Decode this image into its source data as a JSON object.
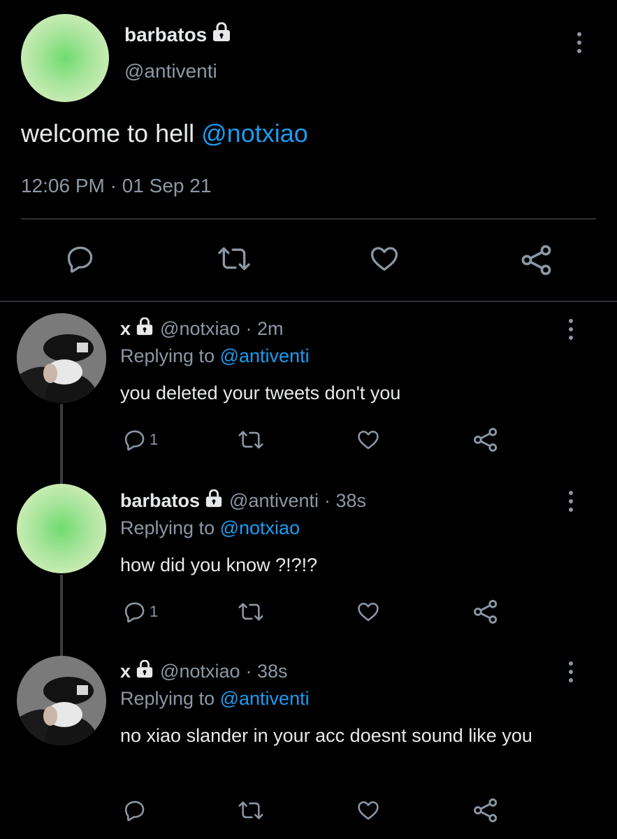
{
  "main_tweet": {
    "name": "barbatos",
    "handle": "@antiventi",
    "text": "welcome to hell",
    "mention": "@notxiao",
    "timestamp": "12:06 PM · 01 Sep 21"
  },
  "replies": [
    {
      "name": "x",
      "handle": "@notxiao",
      "age": "· 2m",
      "replying_prefix": "Replying to",
      "replying_to": "@antiventi",
      "text": "you deleted your tweets don't you",
      "reply_count": "1"
    },
    {
      "name": "barbatos",
      "handle": "@antiventi",
      "age": "· 38s",
      "replying_prefix": "Replying to",
      "replying_to": "@notxiao",
      "text": "how did you know ?!?!?",
      "reply_count": "1"
    },
    {
      "name": "x",
      "handle": "@notxiao",
      "age": "· 38s",
      "replying_prefix": "Replying to",
      "replying_to": "@antiventi",
      "text": "no xiao slander in your acc doesnt sound like you",
      "reply_count": ""
    }
  ],
  "icons": {
    "reply": "reply-icon",
    "retweet": "retweet-icon",
    "like": "heart-icon",
    "share": "share-icon",
    "more": "more-vertical-icon",
    "protected": "lock-icon"
  },
  "colors": {
    "background": "#000000",
    "text": "#e7e9ea",
    "secondary": "#8b98a5",
    "link": "#1d9bf0"
  }
}
